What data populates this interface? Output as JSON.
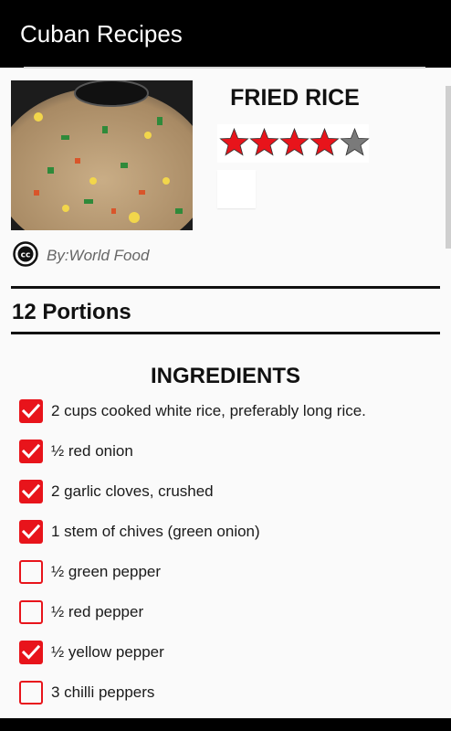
{
  "app": {
    "title": "Cuban Recipes"
  },
  "recipe": {
    "title": "FRIED RICE",
    "rating": 4,
    "rating_max": 5,
    "author": "By:World Food",
    "portions": "12 Portions"
  },
  "ingredients": {
    "title": "INGREDIENTS",
    "items": [
      {
        "label": "2 cups cooked white rice, preferably long rice.",
        "checked": true
      },
      {
        "label": "½ red onion",
        "checked": true
      },
      {
        "label": "2 garlic cloves, crushed",
        "checked": true
      },
      {
        "label": "1 stem of chives (green onion)",
        "checked": true
      },
      {
        "label": "½ green pepper",
        "checked": false
      },
      {
        "label": "½ red pepper",
        "checked": false
      },
      {
        "label": "½ yellow pepper",
        "checked": true
      },
      {
        "label": "3 chilli peppers",
        "checked": false
      }
    ]
  },
  "colors": {
    "appbar": "#000000",
    "accent": "#e8141b",
    "star_on": "#e8141b",
    "star_off": "#7a7a7a"
  }
}
